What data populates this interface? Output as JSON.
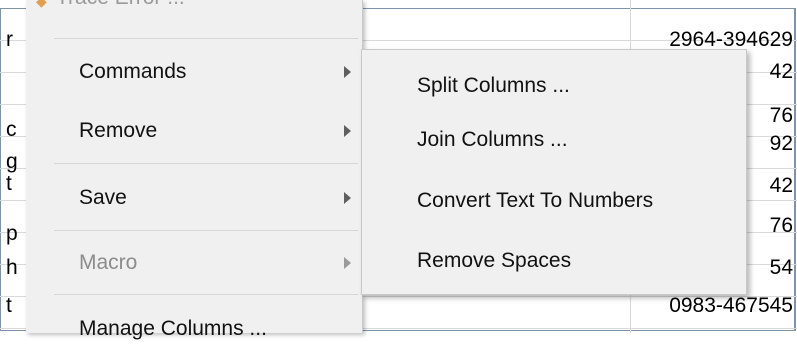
{
  "sheet": {
    "left_cells": [
      "r",
      "",
      "c",
      "g",
      "t",
      "p",
      "h",
      "t"
    ],
    "right_cells": [
      "2964-394629",
      "42",
      "76",
      "92",
      "42",
      "76",
      "54",
      "0983-467545"
    ]
  },
  "context_menu": {
    "top_cut_item": "Trace Error ...",
    "items": [
      {
        "label": "Commands",
        "has_submenu": true,
        "disabled": false
      },
      {
        "label": "Remove",
        "has_submenu": true,
        "disabled": false
      },
      {
        "label": "Save",
        "has_submenu": true,
        "disabled": false
      },
      {
        "label": "Macro",
        "has_submenu": true,
        "disabled": true
      },
      {
        "label": "Manage Columns ...",
        "has_submenu": false,
        "disabled": false
      }
    ]
  },
  "submenu": {
    "items": [
      {
        "label": "Split Columns ..."
      },
      {
        "label": "Join Columns ..."
      },
      {
        "label": "Convert Text To Numbers"
      },
      {
        "label": "Remove Spaces"
      }
    ]
  }
}
